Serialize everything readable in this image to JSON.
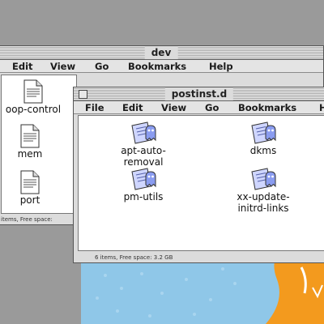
{
  "back_window": {
    "title": "dev",
    "menu": [
      "Edit",
      "View",
      "Go",
      "Bookmarks",
      "Help"
    ],
    "files": [
      "oop-control",
      "mem",
      "port"
    ],
    "status": "items, Free space:"
  },
  "front_window": {
    "title": "postinst.d",
    "menu": [
      "File",
      "Edit",
      "View",
      "Go",
      "Bookmarks",
      "H"
    ],
    "files": [
      "apt-auto-\nremoval",
      "dkms",
      "pm-utils",
      "xx-update-\ninitrd-links"
    ],
    "status": "6 items, Free space: 3.2 GB"
  },
  "icons": {
    "document": "text-document-icon",
    "script": "script-document-icon"
  },
  "colors": {
    "wallpaper_sky": "#8fc7e8",
    "wallpaper_orange": "#f39a1e",
    "desktop_gray": "#9a9a9a",
    "window_gray": "#dcdcdc"
  }
}
